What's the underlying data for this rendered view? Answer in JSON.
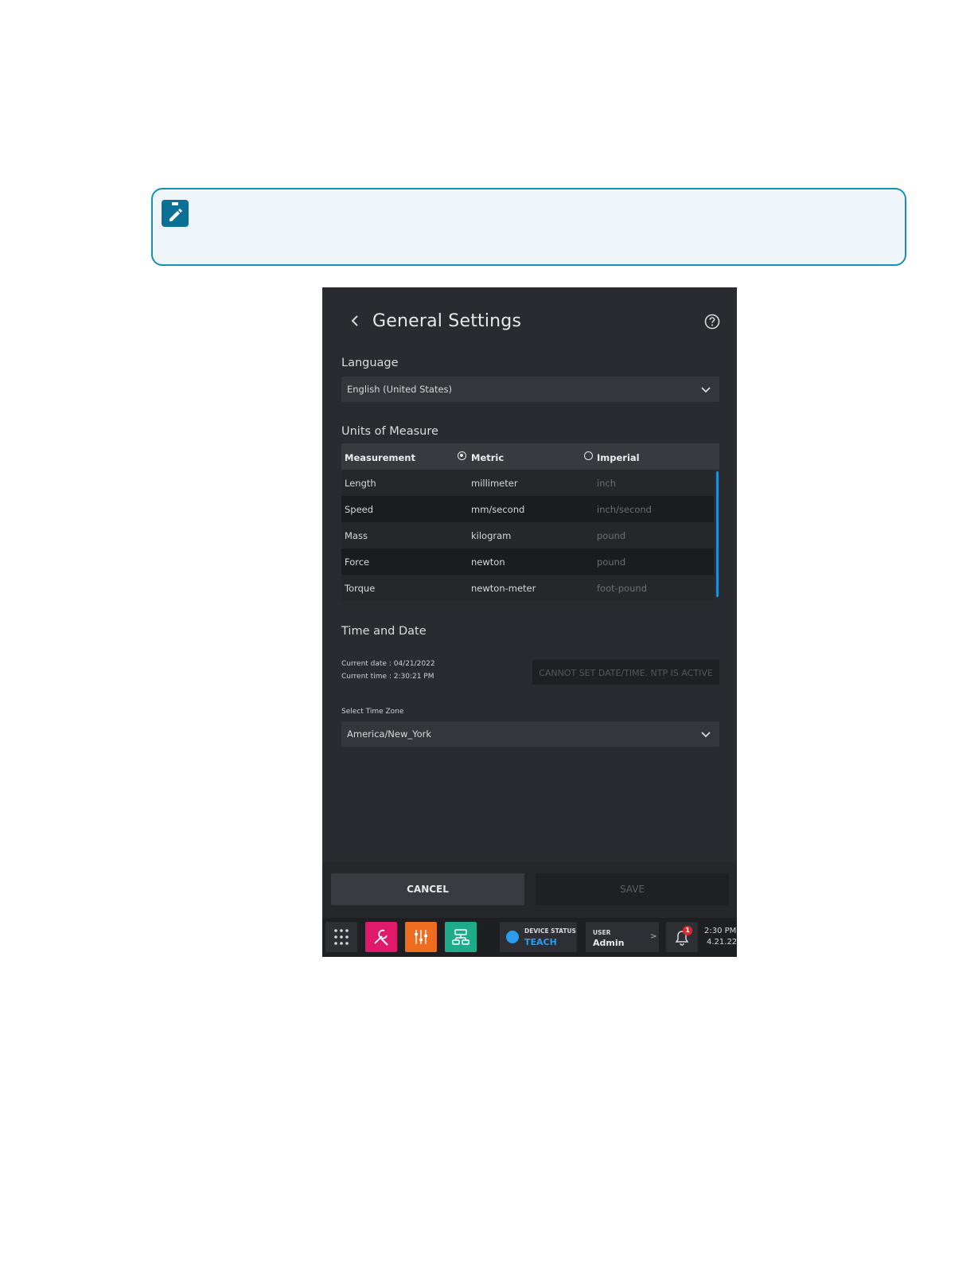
{
  "note": {
    "icon": "pencil-clipboard-icon"
  },
  "header": {
    "title": "General Settings",
    "back_icon": "chevron-left-icon",
    "help_icon": "help-circle-icon"
  },
  "language": {
    "label": "Language",
    "value": "English (United States)"
  },
  "units": {
    "label": "Units of Measure",
    "columns": {
      "measurement": "Measurement",
      "metric": "Metric",
      "imperial": "Imperial"
    },
    "selected": "Metric",
    "rows": [
      {
        "measurement": "Length",
        "metric": "millimeter",
        "imperial": "inch"
      },
      {
        "measurement": "Speed",
        "metric": "mm/second",
        "imperial": "inch/second"
      },
      {
        "measurement": "Mass",
        "metric": "kilogram",
        "imperial": "pound"
      },
      {
        "measurement": "Force",
        "metric": "newton",
        "imperial": "pound"
      },
      {
        "measurement": "Torque",
        "metric": "newton-meter",
        "imperial": "foot-pound"
      }
    ]
  },
  "time_date": {
    "label": "Time and Date",
    "current_date": "Current date : 04/21/2022",
    "current_time": "Current time : 2:30:21 PM",
    "ntp_button": "CANNOT SET DATE/TIME. NTP IS ACTIVE",
    "timezone_label": "Select Time Zone",
    "timezone_value": "America/New_York"
  },
  "footer": {
    "cancel": "CANCEL",
    "save": "SAVE"
  },
  "taskbar": {
    "device_status_label": "DEVICE STATUS",
    "device_status_value": "TEACH",
    "user_label": "USER",
    "user_value": "Admin",
    "user_arrow": ">",
    "notification_count": "1",
    "time": "2:30 PM",
    "date": "4.21.22",
    "colors": {
      "tools": "#e0196b",
      "mixer": "#ee6d1f",
      "network": "#1eab8a",
      "status": "#2a9cf0"
    }
  }
}
